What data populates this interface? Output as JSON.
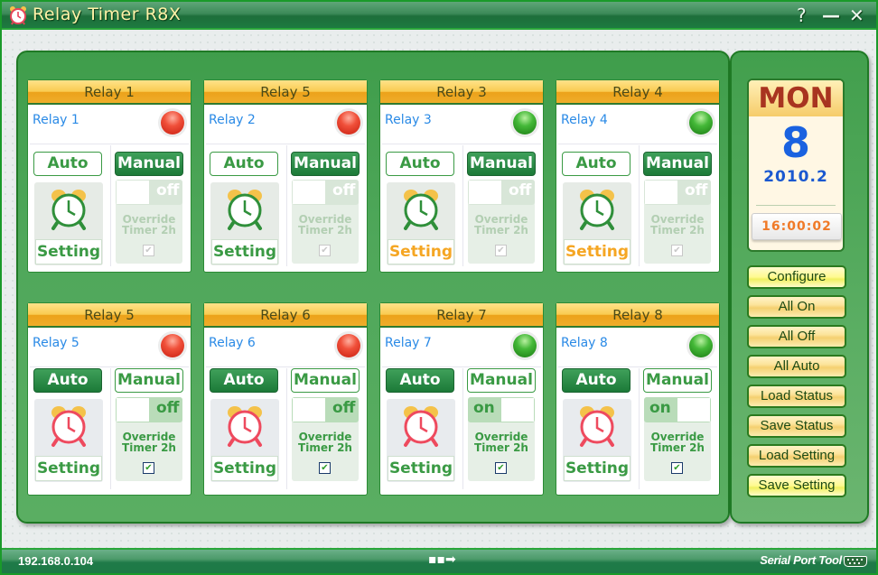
{
  "window": {
    "title": "Relay Timer R8X",
    "help_label": "?",
    "minimize_label": "—",
    "close_label": "✕",
    "icon": "alarm-clock-icon"
  },
  "relays": [
    {
      "header": "Relay 1",
      "name": "Relay 1",
      "led": "red",
      "mode": "manual",
      "auto_label": "Auto",
      "manual_label": "Manual",
      "setting_label": "Setting",
      "setting_highlight": false,
      "toggle_label": "off",
      "toggle_state": "off",
      "override_label_1": "Override",
      "override_label_2": "Timer 2h",
      "override_checked": true,
      "override_enabled": false
    },
    {
      "header": "Relay 5",
      "name": "Relay 2",
      "led": "red",
      "mode": "manual",
      "auto_label": "Auto",
      "manual_label": "Manual",
      "setting_label": "Setting",
      "setting_highlight": false,
      "toggle_label": "off",
      "toggle_state": "off",
      "override_label_1": "Override",
      "override_label_2": "Timer 2h",
      "override_checked": true,
      "override_enabled": false
    },
    {
      "header": "Relay 3",
      "name": "Relay 3",
      "led": "green",
      "mode": "manual",
      "auto_label": "Auto",
      "manual_label": "Manual",
      "setting_label": "Setting",
      "setting_highlight": true,
      "toggle_label": "off",
      "toggle_state": "off",
      "override_label_1": "Override",
      "override_label_2": "Timer 2h",
      "override_checked": true,
      "override_enabled": false
    },
    {
      "header": "Relay 4",
      "name": "Relay 4",
      "led": "green",
      "mode": "manual",
      "auto_label": "Auto",
      "manual_label": "Manual",
      "setting_label": "Setting",
      "setting_highlight": true,
      "toggle_label": "off",
      "toggle_state": "off",
      "override_label_1": "Override",
      "override_label_2": "Timer 2h",
      "override_checked": true,
      "override_enabled": false
    },
    {
      "header": "Relay 5",
      "name": "Relay 5",
      "led": "red",
      "mode": "auto",
      "auto_label": "Auto",
      "manual_label": "Manual",
      "setting_label": "Setting",
      "setting_highlight": false,
      "toggle_label": "off",
      "toggle_state": "off",
      "override_label_1": "Override",
      "override_label_2": "Timer 2h",
      "override_checked": true,
      "override_enabled": true
    },
    {
      "header": "Relay 6",
      "name": "Relay 6",
      "led": "red",
      "mode": "auto",
      "auto_label": "Auto",
      "manual_label": "Manual",
      "setting_label": "Setting",
      "setting_highlight": false,
      "toggle_label": "off",
      "toggle_state": "off",
      "override_label_1": "Override",
      "override_label_2": "Timer 2h",
      "override_checked": true,
      "override_enabled": true
    },
    {
      "header": "Relay 7",
      "name": "Relay 7",
      "led": "green",
      "mode": "auto",
      "auto_label": "Auto",
      "manual_label": "Manual",
      "setting_label": "Setting",
      "setting_highlight": false,
      "toggle_label": "on",
      "toggle_state": "on",
      "override_label_1": "Override",
      "override_label_2": "Timer 2h",
      "override_checked": true,
      "override_enabled": true
    },
    {
      "header": "Relay 8",
      "name": "Relay 8",
      "led": "green",
      "mode": "auto",
      "auto_label": "Auto",
      "manual_label": "Manual",
      "setting_label": "Setting",
      "setting_highlight": false,
      "toggle_label": "on",
      "toggle_state": "on",
      "override_label_1": "Override",
      "override_label_2": "Timer 2h",
      "override_checked": true,
      "override_enabled": true
    }
  ],
  "clock": {
    "day_of_week": "MON",
    "day": "8",
    "year_month": "2010.2",
    "time": "16:00:02"
  },
  "side_buttons": [
    {
      "label": "Configure",
      "highlight": true
    },
    {
      "label": "All On",
      "highlight": false
    },
    {
      "label": "All Off",
      "highlight": false
    },
    {
      "label": "All Auto",
      "highlight": false
    },
    {
      "label": "Load Status",
      "highlight": false
    },
    {
      "label": "Save Status",
      "highlight": false
    },
    {
      "label": "Load Setting",
      "highlight": false
    },
    {
      "label": "Save Setting",
      "highlight": true
    }
  ],
  "statusbar": {
    "ip": "192.168.0.104",
    "arrow": "▪▪➡",
    "brand": "Serial Port Tool"
  },
  "colors": {
    "accent_green": "#1c7a38",
    "label_green": "#3a9a44",
    "setting_orange": "#f5a623",
    "relay_name_blue": "#2a8ae6",
    "led_red": "#e03a24",
    "led_green": "#2f9e2a"
  }
}
